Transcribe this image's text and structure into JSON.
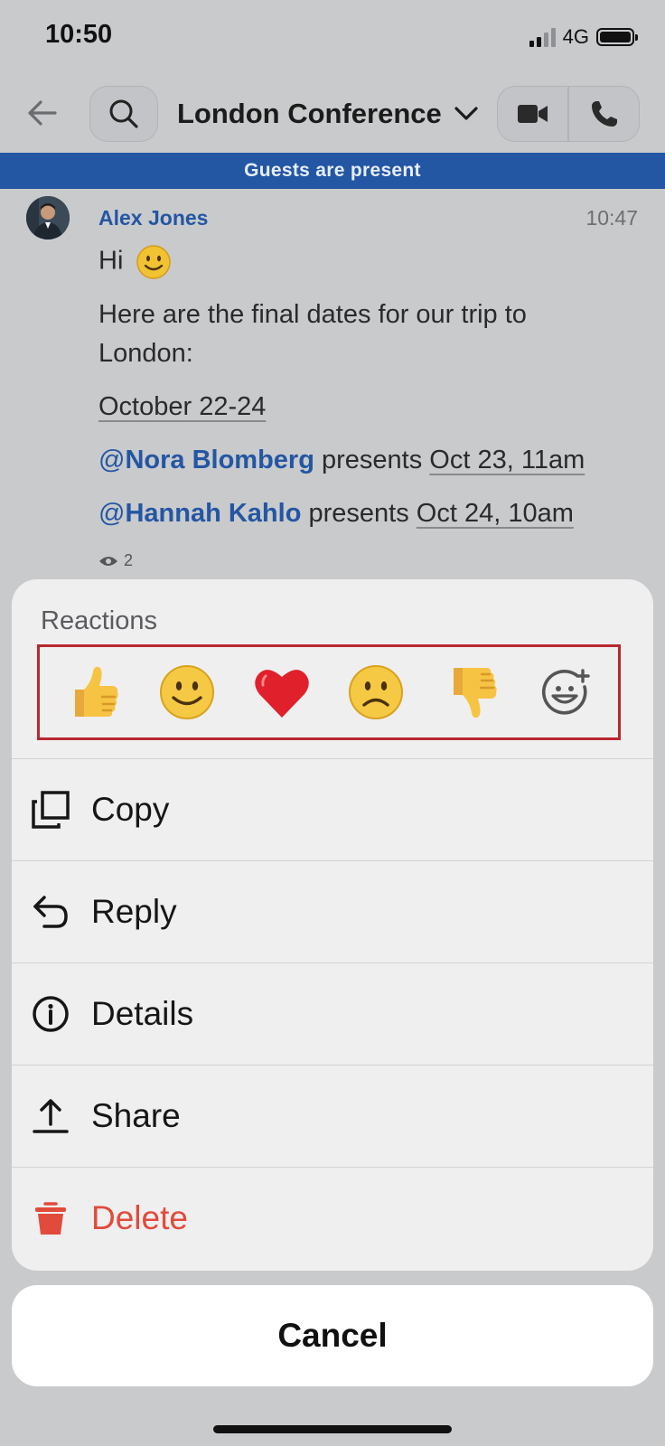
{
  "status_bar": {
    "time": "10:50",
    "network": "4G"
  },
  "header": {
    "title": "London Conference"
  },
  "banner": {
    "text": "Guests are present"
  },
  "message": {
    "sender": "Alex Jones",
    "time": "10:47",
    "greeting": "Hi",
    "line1": "Here are the final dates for our trip to",
    "line2": "London:",
    "dates": "October 22-24",
    "mention1": {
      "at": "@",
      "name": "Nora Blomberg",
      "verb": "presents",
      "date": "Oct 23, 11am"
    },
    "mention2": {
      "at": "@",
      "name": "Hannah Kahlo",
      "verb": "presents",
      "date": "Oct 24, 10am"
    },
    "seen_count": "2"
  },
  "sheet": {
    "reactions_label": "Reactions",
    "reactions": [
      "thumbs-up",
      "smile",
      "heart",
      "frown",
      "thumbs-down",
      "add-reaction"
    ],
    "items": [
      {
        "label": "Copy",
        "icon": "copy-icon"
      },
      {
        "label": "Reply",
        "icon": "reply-icon"
      },
      {
        "label": "Details",
        "icon": "info-icon"
      },
      {
        "label": "Share",
        "icon": "share-icon"
      },
      {
        "label": "Delete",
        "icon": "trash-icon"
      }
    ],
    "cancel_label": "Cancel"
  },
  "colors": {
    "accent": "#2356a3",
    "danger": "#e14b3b",
    "highlight": "#b9272f"
  }
}
